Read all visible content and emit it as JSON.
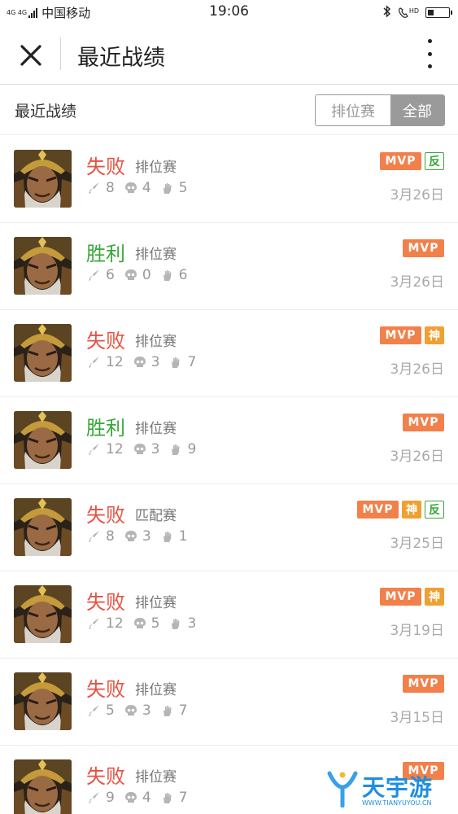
{
  "status_bar": {
    "network": "4G 4G",
    "carrier": "中国移动",
    "time": "19:06",
    "call_label": "HD"
  },
  "nav": {
    "title": "最近战绩"
  },
  "section": {
    "title": "最近战绩",
    "tabs": [
      {
        "label": "排位赛",
        "active": false
      },
      {
        "label": "全部",
        "active": true
      }
    ]
  },
  "matches": [
    {
      "result": "失败",
      "outcome": "lose",
      "mode": "排位赛",
      "kills": "8",
      "deaths": "4",
      "assists": "5",
      "date": "3月26日",
      "badges": [
        "MVP",
        "反"
      ]
    },
    {
      "result": "胜利",
      "outcome": "win",
      "mode": "排位赛",
      "kills": "6",
      "deaths": "0",
      "assists": "6",
      "date": "3月26日",
      "badges": [
        "MVP"
      ]
    },
    {
      "result": "失败",
      "outcome": "lose",
      "mode": "排位赛",
      "kills": "12",
      "deaths": "3",
      "assists": "7",
      "date": "3月26日",
      "badges": [
        "MVP",
        "神"
      ]
    },
    {
      "result": "胜利",
      "outcome": "win",
      "mode": "排位赛",
      "kills": "12",
      "deaths": "3",
      "assists": "9",
      "date": "3月26日",
      "badges": [
        "MVP"
      ]
    },
    {
      "result": "失败",
      "outcome": "lose",
      "mode": "匹配赛",
      "kills": "8",
      "deaths": "3",
      "assists": "1",
      "date": "3月25日",
      "badges": [
        "MVP",
        "神",
        "反"
      ]
    },
    {
      "result": "失败",
      "outcome": "lose",
      "mode": "排位赛",
      "kills": "12",
      "deaths": "5",
      "assists": "3",
      "date": "3月19日",
      "badges": [
        "MVP",
        "神"
      ]
    },
    {
      "result": "失败",
      "outcome": "lose",
      "mode": "排位赛",
      "kills": "5",
      "deaths": "3",
      "assists": "7",
      "date": "3月15日",
      "badges": [
        "MVP"
      ]
    },
    {
      "result": "失败",
      "outcome": "lose",
      "mode": "排位赛",
      "kills": "9",
      "deaths": "4",
      "assists": "7",
      "date": "",
      "badges": [
        "MVP"
      ]
    }
  ],
  "icons": {
    "kills": "sword-icon",
    "deaths": "skull-icon",
    "assists": "hand-icon",
    "avatar": "hero-portrait"
  },
  "colors": {
    "lose": "#e65243",
    "win": "#38a83a",
    "mvp": "#f2804a",
    "god": "#f0a032"
  },
  "watermark": {
    "text": "天宇游",
    "url": "WWW.TIANYUYOU.CN"
  }
}
